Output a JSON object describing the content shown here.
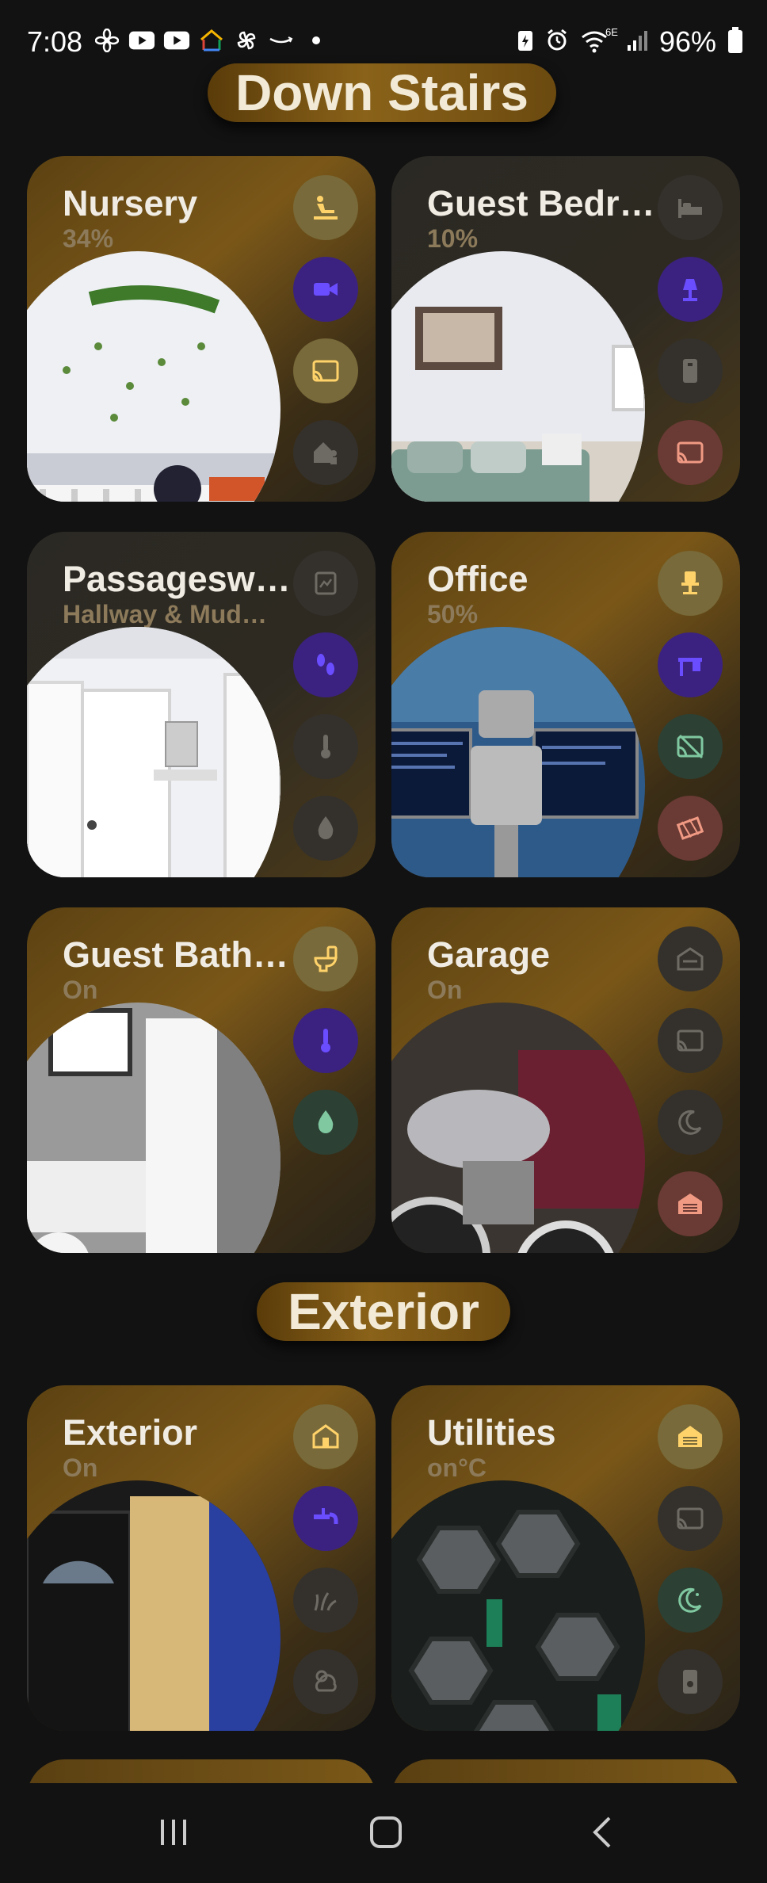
{
  "status_bar": {
    "time": "7:08",
    "battery_text": "96%",
    "left_icons": [
      "fan-icon",
      "youtube-icon",
      "youtube-icon",
      "google-home-icon",
      "pinwheel-icon",
      "amazon-icon",
      "dot-icon"
    ],
    "right_icons": [
      "battery-saver-icon",
      "alarm-icon",
      "wifi-6e-icon",
      "signal-icon",
      "battery-icon"
    ],
    "wifi_label": "6E"
  },
  "sections": {
    "downstairs": "Down Stairs",
    "exterior": "Exterior"
  },
  "cards": [
    {
      "name": "Nursery",
      "sub": "34%",
      "icons": [
        {
          "name": "baby-changing-icon",
          "style": "y"
        },
        {
          "name": "video-camera-icon",
          "style": "p"
        },
        {
          "name": "cast-icon",
          "style": "y2"
        },
        {
          "name": "home-person-icon",
          "style": "dim"
        }
      ]
    },
    {
      "name": "Guest Bedr…",
      "sub": "10%",
      "icons": [
        {
          "name": "bed-icon",
          "style": "dim"
        },
        {
          "name": "lamp-icon",
          "style": "p"
        },
        {
          "name": "speaker-icon",
          "style": "dim"
        },
        {
          "name": "cast-icon",
          "style": "r"
        }
      ]
    },
    {
      "name": "Passagesw…",
      "sub": "Hallway & Mud…",
      "icons": [
        {
          "name": "door-sensor-icon",
          "style": "dim"
        },
        {
          "name": "footsteps-icon",
          "style": "p"
        },
        {
          "name": "thermometer-icon",
          "style": "dim"
        },
        {
          "name": "humidity-icon",
          "style": "dim"
        }
      ]
    },
    {
      "name": "Office",
      "sub": "50%",
      "icons": [
        {
          "name": "desk-chair-icon",
          "style": "y"
        },
        {
          "name": "desk-icon",
          "style": "p"
        },
        {
          "name": "cast-off-icon",
          "style": "g"
        },
        {
          "name": "film-strip-icon",
          "style": "r"
        }
      ]
    },
    {
      "name": "Guest Bath…",
      "sub": "On",
      "icons": [
        {
          "name": "toilet-icon",
          "style": "y"
        },
        {
          "name": "thermometer-icon",
          "style": "p"
        },
        {
          "name": "water-drop-icon",
          "style": "g"
        }
      ]
    },
    {
      "name": "Garage",
      "sub": "On",
      "icons": [
        {
          "name": "garage-icon",
          "style": "dim"
        },
        {
          "name": "cast-icon",
          "style": "dim"
        },
        {
          "name": "night-mode-icon",
          "style": "dim"
        },
        {
          "name": "garage-door-icon",
          "style": "r"
        }
      ]
    },
    {
      "name": "Exterior",
      "sub": "On",
      "icons": [
        {
          "name": "house-icon",
          "style": "y"
        },
        {
          "name": "outdoor-faucet-icon",
          "style": "p"
        },
        {
          "name": "grass-icon",
          "style": "dim"
        },
        {
          "name": "weather-icon",
          "style": "dim"
        }
      ]
    },
    {
      "name": "Utilities",
      "sub": "on°C",
      "icons": [
        {
          "name": "hvac-icon",
          "style": "y"
        },
        {
          "name": "cast-icon",
          "style": "dim"
        },
        {
          "name": "night-mode-icon",
          "style": "g"
        },
        {
          "name": "water-heater-icon",
          "style": "dim"
        }
      ]
    }
  ],
  "colors": {
    "accent_gold": "#8a6219",
    "icon_yellow": "#e8c860",
    "icon_purple": "#5b3ee0",
    "icon_green": "#7fc8a0",
    "icon_red": "#e0806a"
  },
  "nav": {
    "recents": "recents-icon",
    "home": "home-icon",
    "back": "back-icon"
  }
}
